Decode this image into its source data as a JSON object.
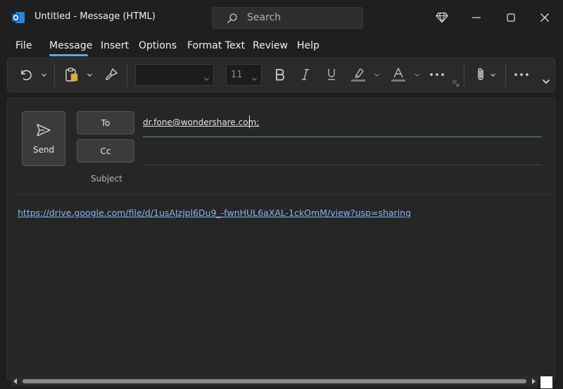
{
  "window": {
    "title": "Untitled  -  Message (HTML)",
    "search_placeholder": "Search"
  },
  "menu": {
    "items": [
      "File",
      "Message",
      "Insert",
      "Options",
      "Format Text",
      "Review",
      "Help"
    ],
    "active": "Message"
  },
  "ribbon": {
    "font_size": "11"
  },
  "compose": {
    "send_label": "Send",
    "to_label": "To",
    "cc_label": "Cc",
    "subject_label": "Subject",
    "to_value": "dr.fone@wondershare.com;",
    "body_link": "https://drive.google.com/file/d/1usAJzjpl6Du9_-fwnHUL6aXAL-1ckOmM/view?usp=sharing"
  },
  "colors": {
    "accent": "#5aa9e6",
    "link": "#8cb4f0",
    "outlook_blue": "#0f6cbd"
  }
}
